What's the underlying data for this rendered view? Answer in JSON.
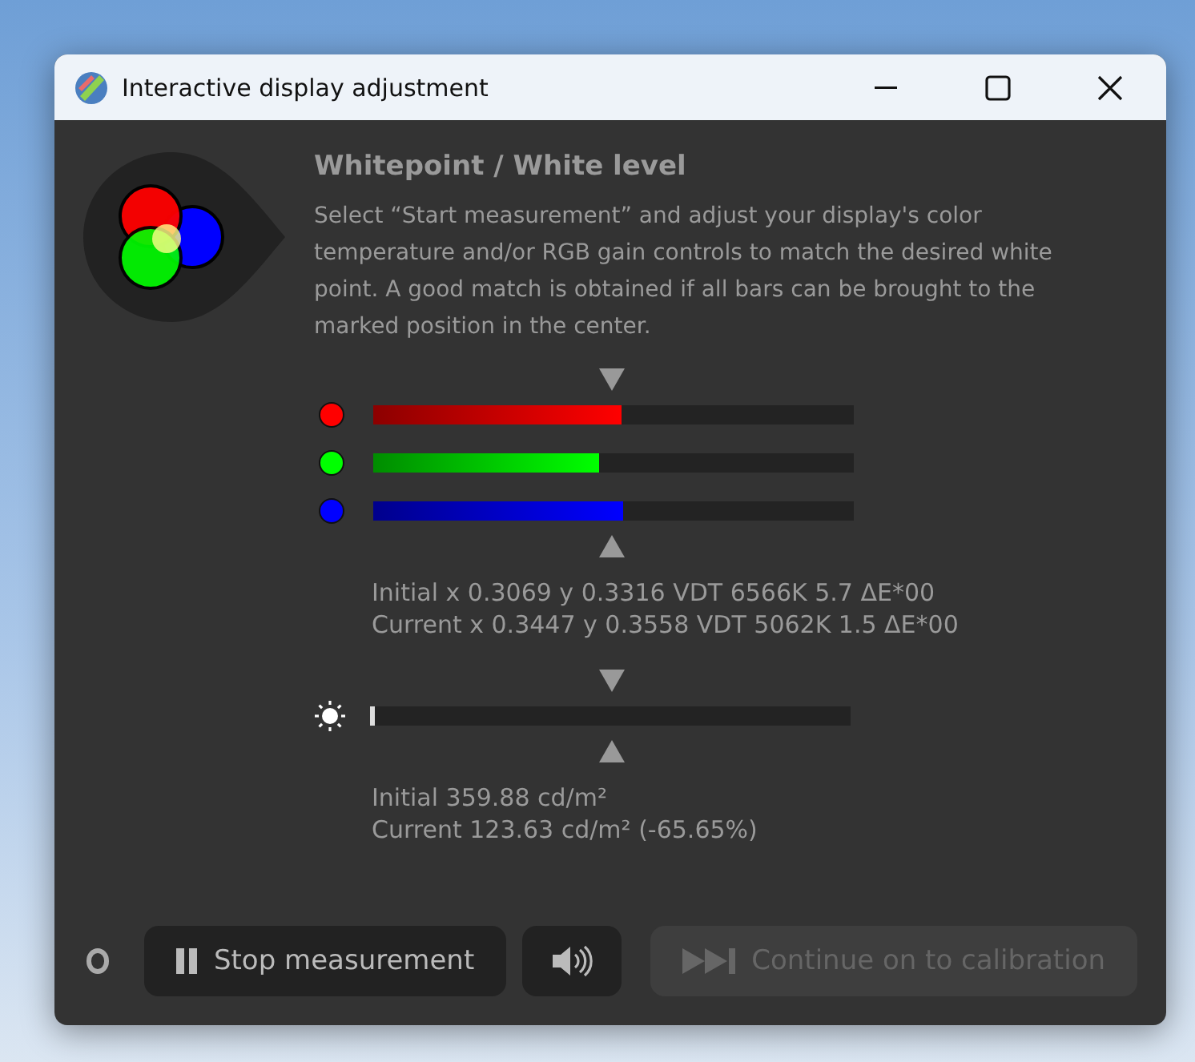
{
  "window": {
    "title": "Interactive display adjustment"
  },
  "heading": "Whitepoint / White level",
  "description": "Select “Start measurement” and adjust your display's color temperature and/or RGB gain controls to match the desired white point. A good match is obtained if all bars can be brought to the marked position in the center.",
  "channels": [
    {
      "color": "#ff0000",
      "level": 0.517
    },
    {
      "color": "#00ff00",
      "level": 0.47
    },
    {
      "color": "#0000ff",
      "level": 0.52
    }
  ],
  "color_readings": [
    "Initial x 0.3069 y 0.3316 VDT 6566K 5.7 ΔE*00",
    "Current x 0.3447 y 0.3558 VDT 5062K 1.5 ΔE*00"
  ],
  "brightness": {
    "level": 0.01
  },
  "brightness_readings": [
    "Initial 359.88 cd/m²",
    "Current 123.63 cd/m² (-65.65%)"
  ],
  "buttons": {
    "stop": {
      "label": "Stop measurement",
      "disabled": false
    },
    "continue": {
      "label": "Continue on to calibration",
      "disabled": true
    }
  }
}
